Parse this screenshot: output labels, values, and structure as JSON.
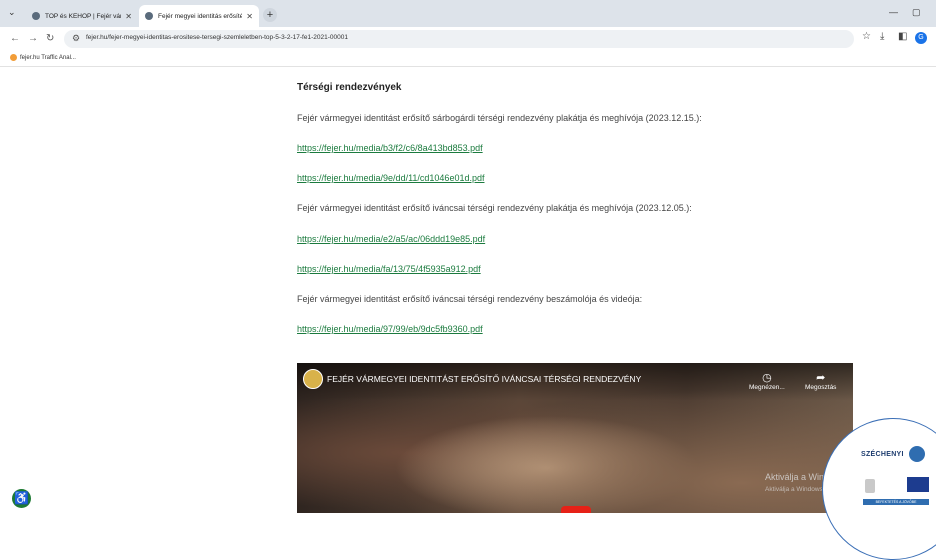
{
  "browser": {
    "tabs": [
      {
        "title": "TOP és KEHOP | Fejér vármegy",
        "active": false
      },
      {
        "title": "Fejér megyei identitás erősítés",
        "active": true
      }
    ],
    "url": "fejer.hu/fejer-megyei-identitas-erositese-tersegi-szemleletben-top-5-3-2-17-fe1-2021-00001",
    "bookmark": "fejer.hu Traffic Anal...",
    "profile_initial": "G",
    "icons": {
      "menu": "chevron-down-icon",
      "back": "back-arrow-icon",
      "forward": "forward-arrow-icon",
      "reload": "reload-icon",
      "star": "star-icon",
      "download": "download-icon",
      "sidepanel": "side-panel-icon"
    }
  },
  "page": {
    "heading": "Térségi rendezvények",
    "items": [
      {
        "kind": "text",
        "text": "Fejér vármegyei identitást erősítő sárbogárdi térségi rendezvény plakátja és meghívója (2023.12.15.):"
      },
      {
        "kind": "link",
        "text": "https://fejer.hu/media/b3/f2/c6/8a413bd853.pdf"
      },
      {
        "kind": "link",
        "text": "https://fejer.hu/media/9e/dd/11/cd1046e01d.pdf"
      },
      {
        "kind": "text",
        "text": "Fejér vármegyei identitást erősítő iváncsai térségi rendezvény plakátja és meghívója (2023.12.05.):"
      },
      {
        "kind": "link",
        "text": "https://fejer.hu/media/e2/a5/ac/06ddd19e85.pdf"
      },
      {
        "kind": "link",
        "text": "https://fejer.hu/media/fa/13/75/4f5935a912.pdf"
      },
      {
        "kind": "text",
        "text": "Fejér vármegyei identitást erősítő iváncsai térségi rendezvény beszámolója és videója:"
      },
      {
        "kind": "link",
        "text": "https://fejer.hu/media/97/99/eb/9dc5fb9360.pdf"
      }
    ],
    "video": {
      "title": "FEJÉR VÁRMEGYEI IDENTITÁST ERŐSÍTŐ IVÁNCSAI TÉRSÉGI RENDEZVÉNY",
      "watch_later": "Megnézen...",
      "share": "Megosztás"
    },
    "windows_watermark": {
      "line1": "Aktiválja a Windowst",
      "line2": "Aktiválja a Windows-t a Gépházban"
    },
    "szechenyi": {
      "title": "SZÉCHENYI",
      "banner": "BEFEKTETÉS A JÖVŐBE"
    },
    "colors": {
      "link": "#1b7b3e",
      "accessibility": "#1e7a33",
      "youtube_red": "#e62117"
    }
  }
}
